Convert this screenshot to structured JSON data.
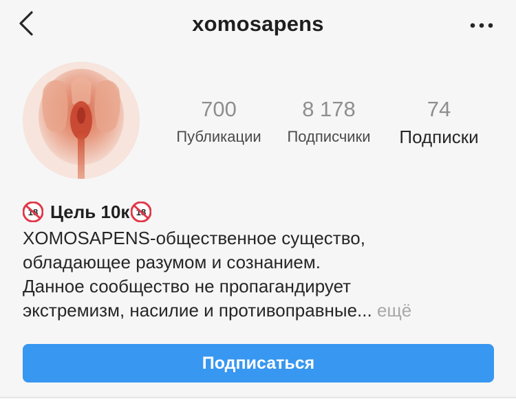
{
  "header": {
    "username": "xomosapens",
    "back_icon": "chevron-left-icon",
    "more_icon": "ellipsis-horizontal-icon"
  },
  "profile": {
    "avatar_icon": "profile-avatar"
  },
  "stats": {
    "posts": {
      "value": "700",
      "label": "Публикации"
    },
    "followers": {
      "value": "8 178",
      "label": "Подписчики"
    },
    "following": {
      "value": "74",
      "label": "Подписки"
    }
  },
  "bio": {
    "emoji": "🔞",
    "name": "Цель 10к",
    "lines": [
      "XOMOSAPENS-общественное существо,",
      "обладающее разумом и сознанием.",
      "Данное сообщество не пропагандирует",
      "экстремизм, насилие и противоправные..."
    ],
    "more_label": "ещё"
  },
  "actions": {
    "follow_label": "Подписаться"
  },
  "colors": {
    "accent": "#3897f0",
    "background": "#f6f6f6",
    "muted_text": "#8e8e8e",
    "emoji_red": "#e0384a"
  }
}
